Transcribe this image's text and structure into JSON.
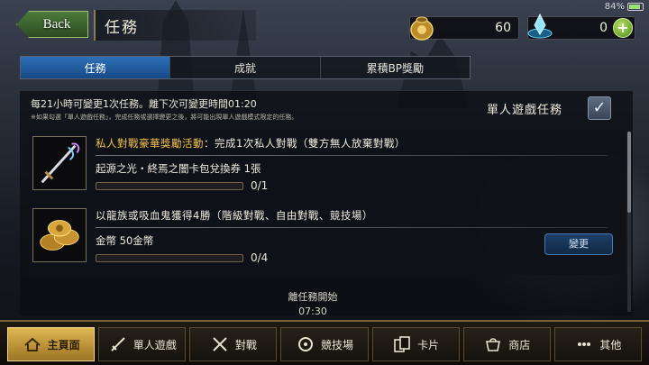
{
  "status": {
    "battery": "84%"
  },
  "header": {
    "back_label": "Back",
    "title": "任務"
  },
  "resources": {
    "gold": "60",
    "bp": "0"
  },
  "tabs": [
    {
      "label": "任務",
      "active": true
    },
    {
      "label": "成就",
      "active": false
    },
    {
      "label": "累積BP獎勵",
      "active": false
    }
  ],
  "info": {
    "line1": "每21小時可變更1次任務。離下次可變更時間01:20",
    "line2": "※如果勾選「單人遊戲任務」，完成任務或選擇變更之後，將可能出現單人遊戲模式限定的任務。"
  },
  "solo_toggle": {
    "label": "單人遊戲任務",
    "checked": true
  },
  "quests": [
    {
      "title_highlight": "私人對戰豪華獎勵活動",
      "title_rest": "：完成1次私人對戰（雙方無人放棄對戰）",
      "reward": "起源之光・終焉之闇卡包兌換券 1張",
      "progress_text": "0/1",
      "progress": 0,
      "icon": "sword-icon"
    },
    {
      "title_highlight": "",
      "title_rest": "以龍族或吸血鬼獲得4勝（階級對戰、自由對戰、競技場）",
      "reward": "金幣 50金幣",
      "progress_text": "0/4",
      "progress": 0,
      "icon": "gold-coins-icon",
      "change_label": "變更"
    }
  ],
  "next_quest": {
    "label": "離任務開始",
    "time": "07:30"
  },
  "nav": [
    {
      "label": "主頁面",
      "icon": "home-icon",
      "active": true
    },
    {
      "label": "單人遊戲",
      "icon": "solo-sword-icon",
      "active": false
    },
    {
      "label": "對戰",
      "icon": "crossed-swords-icon",
      "active": false
    },
    {
      "label": "競技場",
      "icon": "arena-icon",
      "active": false
    },
    {
      "label": "卡片",
      "icon": "cards-icon",
      "active": false
    },
    {
      "label": "商店",
      "icon": "shop-icon",
      "active": false
    },
    {
      "label": "其他",
      "icon": "other-icon",
      "active": false
    }
  ],
  "colors": {
    "accent_blue": "#2d6fb8",
    "highlight_gold": "#f3c34b",
    "back_green": "#4d7a3b"
  }
}
